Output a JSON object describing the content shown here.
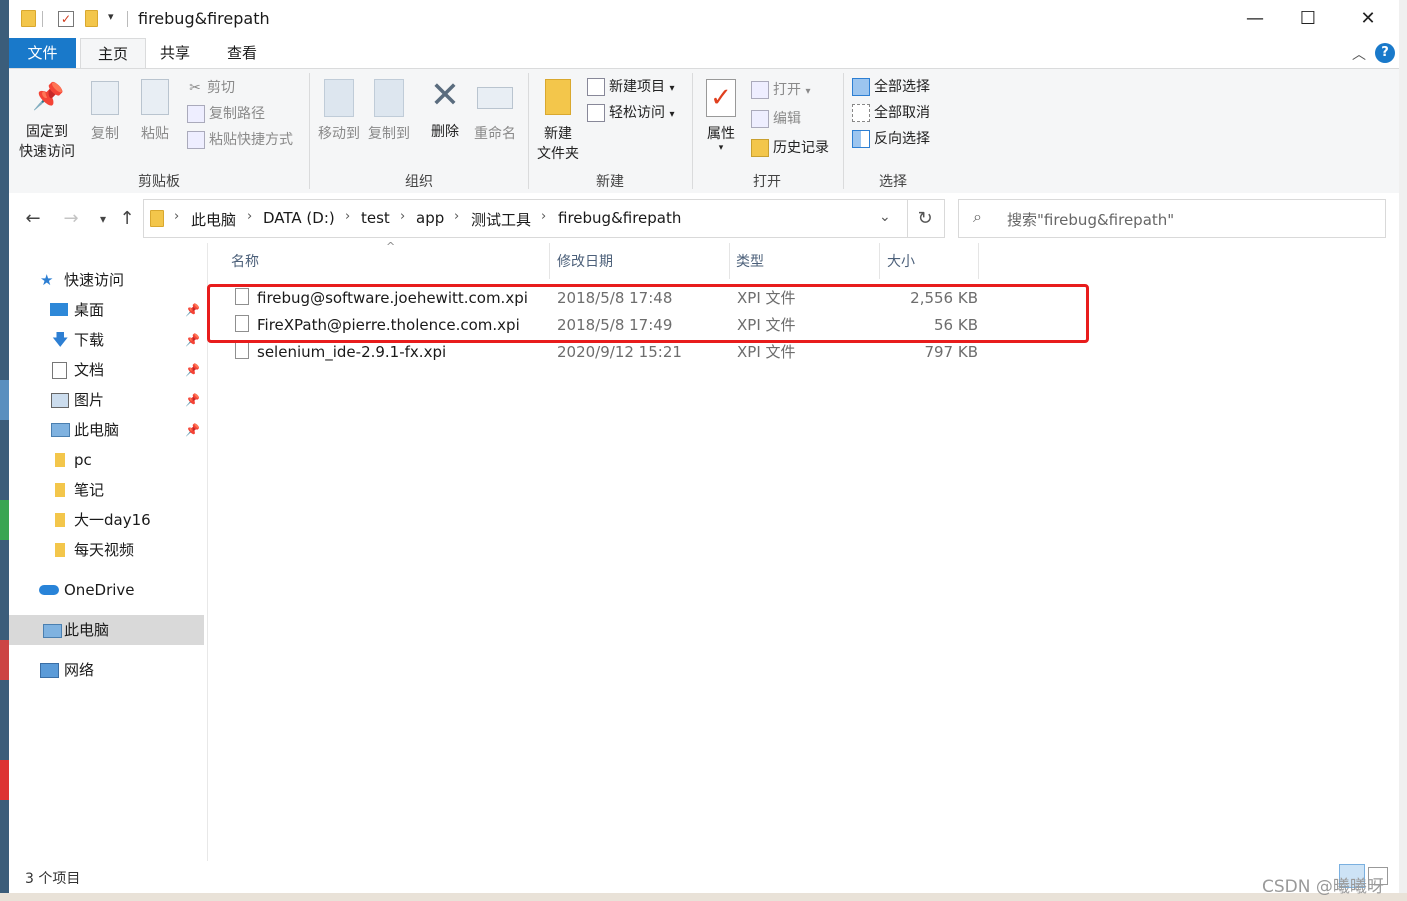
{
  "window": {
    "title": "firebug&firepath",
    "controls": {
      "minimize": "—",
      "maximize": "☐",
      "close": "✕"
    }
  },
  "tabs": {
    "file": "文件",
    "home": "主页",
    "share": "共享",
    "view": "查看"
  },
  "ribbon": {
    "pin_quick": "固定到\n快速访问",
    "pin_quick_l1": "固定到",
    "pin_quick_l2": "快速访问",
    "copy": "复制",
    "paste": "粘贴",
    "cut": "剪切",
    "copy_path": "复制路径",
    "paste_shortcut": "粘贴快捷方式",
    "clipboard_group": "剪贴板",
    "move_to": "移动到",
    "copy_to": "复制到",
    "delete": "删除",
    "rename": "重命名",
    "organize_group": "组织",
    "new_folder_l1": "新建",
    "new_folder_l2": "文件夹",
    "new_item": "新建项目",
    "easy_access": "轻松访问",
    "new_group": "新建",
    "properties": "属性",
    "open": "打开",
    "edit": "编辑",
    "history": "历史记录",
    "open_group": "打开",
    "select_all": "全部选择",
    "select_none": "全部取消",
    "invert_selection": "反向选择",
    "select_group": "选择"
  },
  "address": {
    "crumbs": [
      "此电脑",
      "DATA (D:)",
      "test",
      "app",
      "测试工具",
      "firebug&firepath"
    ],
    "search_placeholder": "搜索\"firebug&firepath\""
  },
  "nav": {
    "quick_access": "快速访问",
    "items": [
      "桌面",
      "下载",
      "文档",
      "图片",
      "此电脑",
      "pc",
      "笔记",
      "大一day16",
      "每天视频"
    ],
    "onedrive": "OneDrive",
    "this_pc": "此电脑",
    "network": "网络"
  },
  "columns": {
    "name": "名称",
    "modified": "修改日期",
    "type": "类型",
    "size": "大小"
  },
  "files": [
    {
      "name": "firebug@software.joehewitt.com.xpi",
      "modified": "2018/5/8 17:48",
      "type": "XPI 文件",
      "size": "2,556 KB"
    },
    {
      "name": "FireXPath@pierre.tholence.com.xpi",
      "modified": "2018/5/8 17:49",
      "type": "XPI 文件",
      "size": "56 KB"
    },
    {
      "name": "selenium_ide-2.9.1-fx.xpi",
      "modified": "2020/9/12 15:21",
      "type": "XPI 文件",
      "size": "797 KB"
    }
  ],
  "status": {
    "count": "3 个项目"
  },
  "watermark": "CSDN @曦曦呀",
  "colors": {
    "accent": "#1979ca",
    "highlight": "#e81c1c",
    "folder": "#f3c64b"
  }
}
